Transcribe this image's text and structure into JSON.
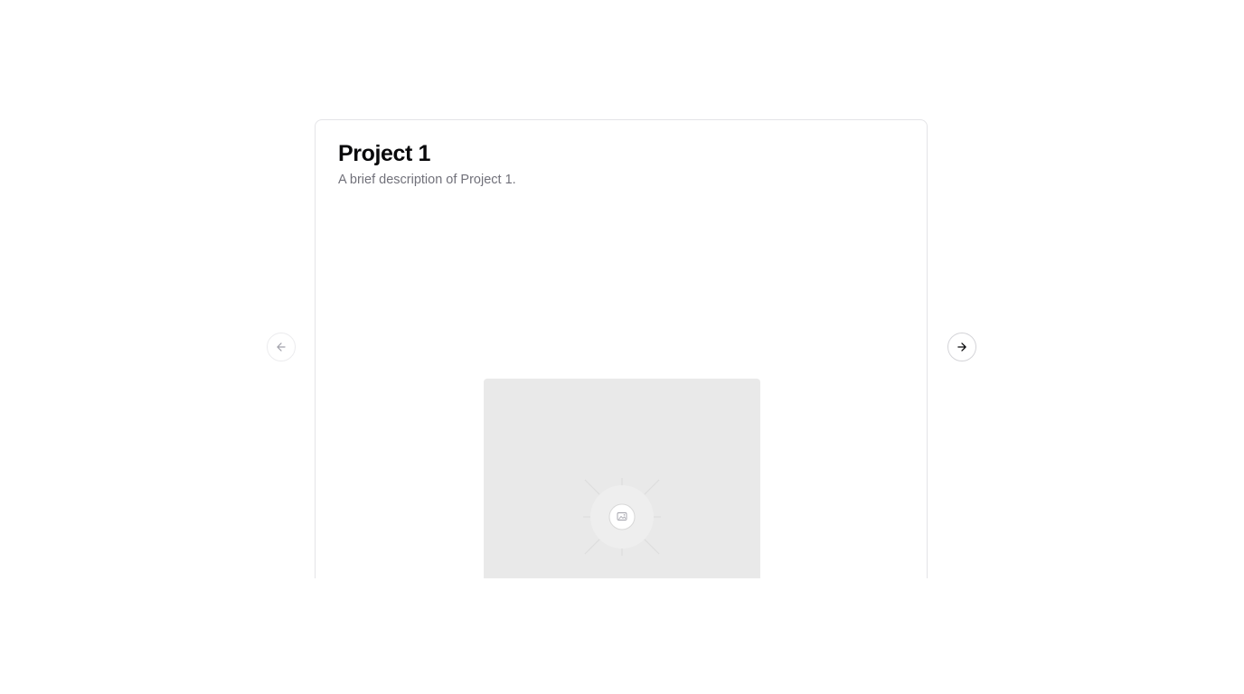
{
  "carousel": {
    "slide": {
      "title": "Project 1",
      "description": "A brief description of Project 1.",
      "image_icon": "image-placeholder-icon"
    },
    "prev_icon": "arrow-left-icon",
    "next_icon": "arrow-right-icon",
    "prev_disabled": true,
    "next_disabled": false
  },
  "colors": {
    "title": "#09090b",
    "description": "#71717a",
    "card_border": "#e4e4e7",
    "placeholder_bg": "#e9e9e9"
  }
}
